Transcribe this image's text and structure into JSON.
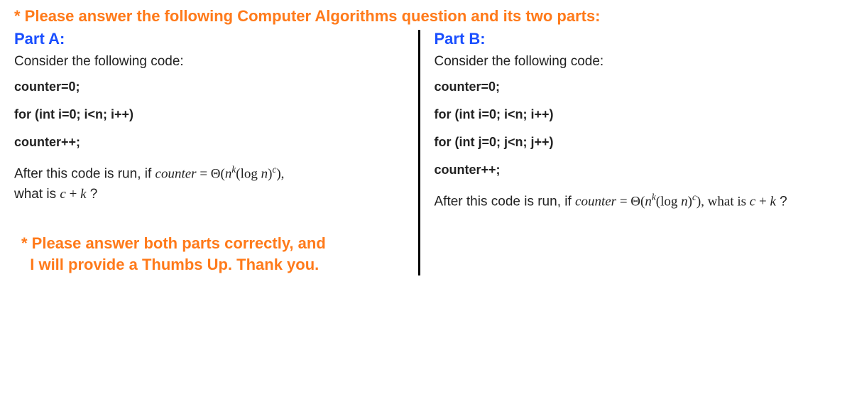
{
  "title": "* Please answer the following Computer Algorithms question and its two parts:",
  "partA": {
    "label": "Part A:",
    "intro": "Consider the following code:",
    "code": {
      "l1": "counter=0;",
      "l2": "for (int i=0; i<n; i++)",
      "l3": "counter++;"
    },
    "after1": "After this code is run, if ",
    "counter_word": "counter",
    "equals": " = ",
    "theta_open": "Θ(",
    "n": "n",
    "k": "k",
    "logn_open": "(log ",
    "close_paren": ")",
    "c": "c",
    "close_all": "),",
    "after2": "what is ",
    "c2": "c",
    "plus": " + ",
    "k2": "k",
    "qmark": " ?"
  },
  "partB": {
    "label": "Part B:",
    "intro": "Consider the following code:",
    "code": {
      "l1": "counter=0;",
      "l2": "for (int i=0; i<n; i++)",
      "l3": "for (int j=0; j<n; j++)",
      "l4": "counter++;"
    },
    "after1": "After this code is run, if ",
    "counter_word": "counter",
    "equals": " = ",
    "theta_open": "Θ(",
    "n": "n",
    "k": "k",
    "logn_open": "(log ",
    "close_paren": ")",
    "c": "c",
    "close_all": "), what is ",
    "c2": "c",
    "plus": " + ",
    "k2": "k",
    "qmark": " ?"
  },
  "footer": {
    "l1": "* Please answer both parts correctly, and",
    "l2": "I will provide a Thumbs Up. Thank you."
  }
}
